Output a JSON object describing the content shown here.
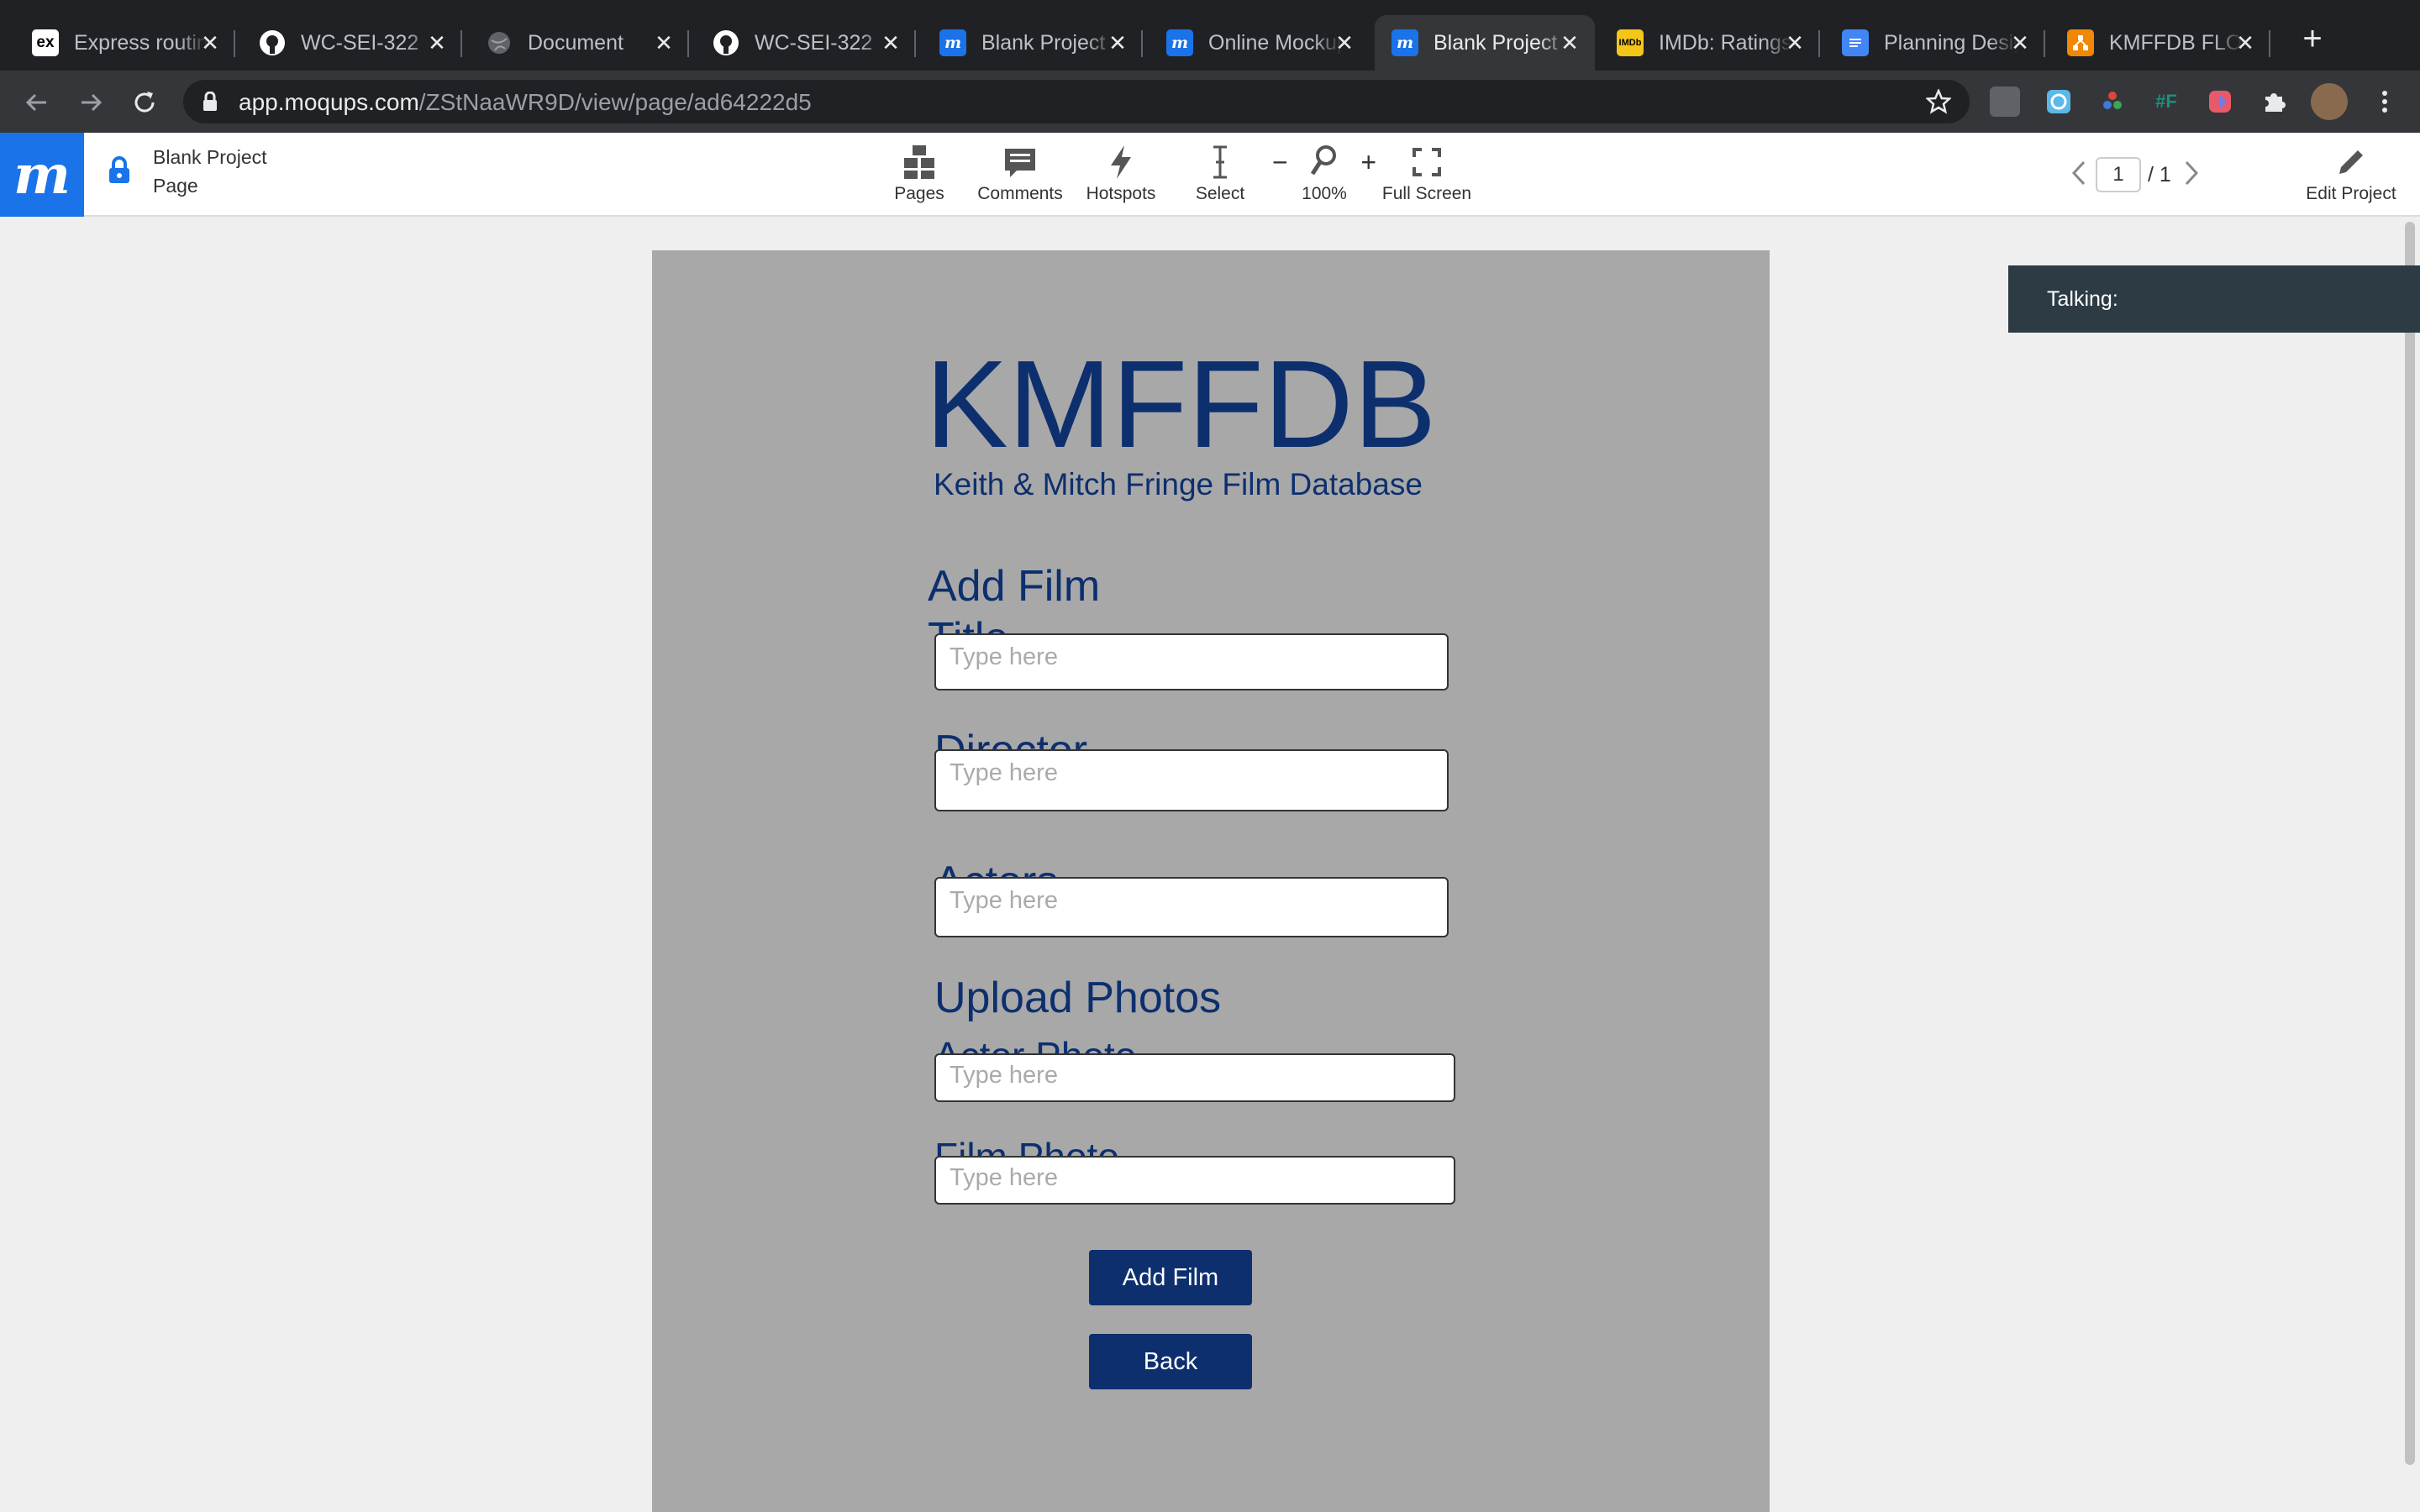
{
  "browser": {
    "tabs": [
      {
        "title": "Express routing",
        "favicon": "ex"
      },
      {
        "title": "WC-SEI-322",
        "favicon": "github-icon"
      },
      {
        "title": "Document",
        "favicon": "globe-icon"
      },
      {
        "title": "WC-SEI-322",
        "favicon": "github-icon"
      },
      {
        "title": "Blank Project",
        "favicon": "moqups-icon"
      },
      {
        "title": "Online Mockup",
        "favicon": "moqups-icon"
      },
      {
        "title": "Blank Project",
        "favicon": "moqups-icon"
      },
      {
        "title": "IMDb: Ratings",
        "favicon": "imdb-icon"
      },
      {
        "title": "Planning Design",
        "favicon": "docs-icon"
      },
      {
        "title": "KMFFDB FLOW",
        "favicon": "drawio-icon"
      }
    ],
    "url_host": "app.moqups.com",
    "url_path": "/ZStNaaWR9D/view/page/ad64222d5"
  },
  "app": {
    "logo": "m",
    "project_name": "Blank Project",
    "page_name": "Page",
    "toolbar": {
      "pages": "Pages",
      "comments": "Comments",
      "hotspots": "Hotspots",
      "select": "Select",
      "zoom": "100%",
      "fullscreen": "Full Screen"
    },
    "pager": {
      "current": "1",
      "total": "/ 1"
    },
    "edit_project": "Edit Project",
    "talking": "Talking:"
  },
  "mockup": {
    "brand": "KMFFDB",
    "tagline": "Keith & Mitch Fringe Film Database",
    "heading": "Add Film",
    "fields": {
      "title_label": "Title",
      "director_label": "Director",
      "actors_label": "Actors",
      "upload_heading": "Upload Photos",
      "actor_photo_label": "Actor Photo",
      "film_photo_label": "Film Photo",
      "placeholder": "Type here"
    },
    "add_button": "Add Film",
    "back_button": "Back"
  },
  "colors": {
    "brand_navy": "#0d2f6e",
    "moqups_blue": "#1a73e8",
    "page_gray": "#a8a8a8"
  }
}
